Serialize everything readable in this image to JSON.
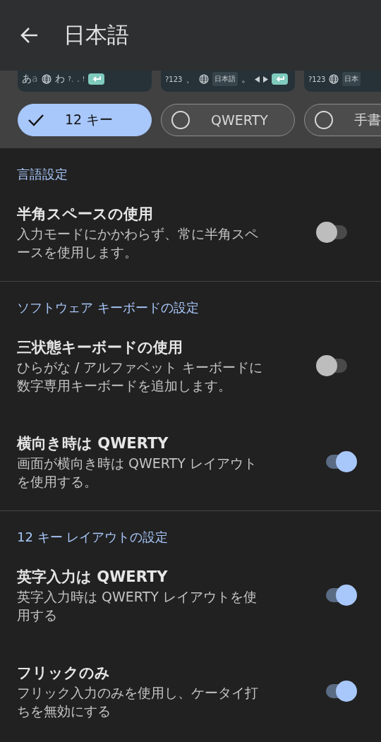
{
  "app_bar": {
    "title": "日本語"
  },
  "layouts": [
    {
      "keys": [
        {
          "kind": "kana",
          "label": "あ",
          "sub": "a"
        },
        {
          "kind": "globe"
        },
        {
          "kind": "text",
          "label": "わ"
        },
        {
          "kind": "punct",
          "label": "?、。!"
        },
        {
          "kind": "enter"
        }
      ]
    },
    {
      "keys": [
        {
          "kind": "text",
          "label": "?123"
        },
        {
          "kind": "text",
          "label": "、"
        },
        {
          "kind": "globe"
        },
        {
          "kind": "space",
          "label": "日本語"
        },
        {
          "kind": "text",
          "label": "。"
        },
        {
          "kind": "left"
        },
        {
          "kind": "right"
        },
        {
          "kind": "enter"
        }
      ]
    },
    {
      "keys": [
        {
          "kind": "text",
          "label": "?123"
        },
        {
          "kind": "globe"
        },
        {
          "kind": "space",
          "label": "日本"
        }
      ]
    }
  ],
  "layout_chips": [
    {
      "label": "12 キー",
      "selected": true
    },
    {
      "label": "QWERTY",
      "selected": false
    },
    {
      "label": "手書",
      "selected": false
    }
  ],
  "sections": [
    {
      "heading": "言語設定",
      "items": [
        {
          "title": "半角スペースの使用",
          "description": "入力モードにかかわらず、常に半角スペースを使用します。",
          "on": false
        }
      ]
    },
    {
      "heading": "ソフトウェア キーボードの設定",
      "items": [
        {
          "title": "三状態キーボードの使用",
          "description": "ひらがな / アルファベット キーボードに数字専用キーボードを追加します。",
          "on": false
        },
        {
          "title": "横向き時は QWERTY",
          "description": "画面が横向き時は QWERTY レイアウトを使用する。",
          "on": true
        }
      ]
    },
    {
      "heading": "12 キー レイアウトの設定",
      "items": [
        {
          "title": "英字入力は QWERTY",
          "description": "英字入力時は QWERTY レイアウトを使用する",
          "on": true
        },
        {
          "title": "フリックのみ",
          "description": "フリック入力のみを使用し、ケータイ打ちを無効にする",
          "on": true
        }
      ]
    }
  ]
}
